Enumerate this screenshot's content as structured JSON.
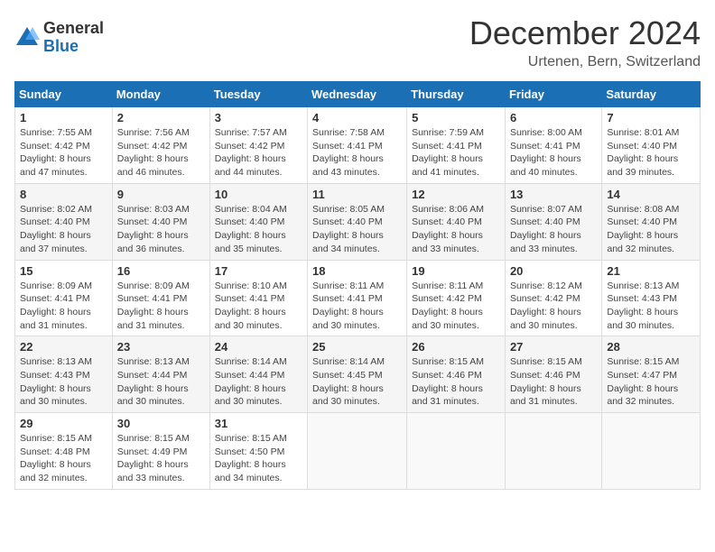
{
  "logo": {
    "general": "General",
    "blue": "Blue"
  },
  "title": "December 2024",
  "location": "Urtenen, Bern, Switzerland",
  "days_of_week": [
    "Sunday",
    "Monday",
    "Tuesday",
    "Wednesday",
    "Thursday",
    "Friday",
    "Saturday"
  ],
  "weeks": [
    [
      {
        "day": "1",
        "sunrise": "7:55 AM",
        "sunset": "4:42 PM",
        "daylight": "8 hours and 47 minutes."
      },
      {
        "day": "2",
        "sunrise": "7:56 AM",
        "sunset": "4:42 PM",
        "daylight": "8 hours and 46 minutes."
      },
      {
        "day": "3",
        "sunrise": "7:57 AM",
        "sunset": "4:42 PM",
        "daylight": "8 hours and 44 minutes."
      },
      {
        "day": "4",
        "sunrise": "7:58 AM",
        "sunset": "4:41 PM",
        "daylight": "8 hours and 43 minutes."
      },
      {
        "day": "5",
        "sunrise": "7:59 AM",
        "sunset": "4:41 PM",
        "daylight": "8 hours and 41 minutes."
      },
      {
        "day": "6",
        "sunrise": "8:00 AM",
        "sunset": "4:41 PM",
        "daylight": "8 hours and 40 minutes."
      },
      {
        "day": "7",
        "sunrise": "8:01 AM",
        "sunset": "4:40 PM",
        "daylight": "8 hours and 39 minutes."
      }
    ],
    [
      {
        "day": "8",
        "sunrise": "8:02 AM",
        "sunset": "4:40 PM",
        "daylight": "8 hours and 37 minutes."
      },
      {
        "day": "9",
        "sunrise": "8:03 AM",
        "sunset": "4:40 PM",
        "daylight": "8 hours and 36 minutes."
      },
      {
        "day": "10",
        "sunrise": "8:04 AM",
        "sunset": "4:40 PM",
        "daylight": "8 hours and 35 minutes."
      },
      {
        "day": "11",
        "sunrise": "8:05 AM",
        "sunset": "4:40 PM",
        "daylight": "8 hours and 34 minutes."
      },
      {
        "day": "12",
        "sunrise": "8:06 AM",
        "sunset": "4:40 PM",
        "daylight": "8 hours and 33 minutes."
      },
      {
        "day": "13",
        "sunrise": "8:07 AM",
        "sunset": "4:40 PM",
        "daylight": "8 hours and 33 minutes."
      },
      {
        "day": "14",
        "sunrise": "8:08 AM",
        "sunset": "4:40 PM",
        "daylight": "8 hours and 32 minutes."
      }
    ],
    [
      {
        "day": "15",
        "sunrise": "8:09 AM",
        "sunset": "4:41 PM",
        "daylight": "8 hours and 31 minutes."
      },
      {
        "day": "16",
        "sunrise": "8:09 AM",
        "sunset": "4:41 PM",
        "daylight": "8 hours and 31 minutes."
      },
      {
        "day": "17",
        "sunrise": "8:10 AM",
        "sunset": "4:41 PM",
        "daylight": "8 hours and 30 minutes."
      },
      {
        "day": "18",
        "sunrise": "8:11 AM",
        "sunset": "4:41 PM",
        "daylight": "8 hours and 30 minutes."
      },
      {
        "day": "19",
        "sunrise": "8:11 AM",
        "sunset": "4:42 PM",
        "daylight": "8 hours and 30 minutes."
      },
      {
        "day": "20",
        "sunrise": "8:12 AM",
        "sunset": "4:42 PM",
        "daylight": "8 hours and 30 minutes."
      },
      {
        "day": "21",
        "sunrise": "8:13 AM",
        "sunset": "4:43 PM",
        "daylight": "8 hours and 30 minutes."
      }
    ],
    [
      {
        "day": "22",
        "sunrise": "8:13 AM",
        "sunset": "4:43 PM",
        "daylight": "8 hours and 30 minutes."
      },
      {
        "day": "23",
        "sunrise": "8:13 AM",
        "sunset": "4:44 PM",
        "daylight": "8 hours and 30 minutes."
      },
      {
        "day": "24",
        "sunrise": "8:14 AM",
        "sunset": "4:44 PM",
        "daylight": "8 hours and 30 minutes."
      },
      {
        "day": "25",
        "sunrise": "8:14 AM",
        "sunset": "4:45 PM",
        "daylight": "8 hours and 30 minutes."
      },
      {
        "day": "26",
        "sunrise": "8:15 AM",
        "sunset": "4:46 PM",
        "daylight": "8 hours and 31 minutes."
      },
      {
        "day": "27",
        "sunrise": "8:15 AM",
        "sunset": "4:46 PM",
        "daylight": "8 hours and 31 minutes."
      },
      {
        "day": "28",
        "sunrise": "8:15 AM",
        "sunset": "4:47 PM",
        "daylight": "8 hours and 32 minutes."
      }
    ],
    [
      {
        "day": "29",
        "sunrise": "8:15 AM",
        "sunset": "4:48 PM",
        "daylight": "8 hours and 32 minutes."
      },
      {
        "day": "30",
        "sunrise": "8:15 AM",
        "sunset": "4:49 PM",
        "daylight": "8 hours and 33 minutes."
      },
      {
        "day": "31",
        "sunrise": "8:15 AM",
        "sunset": "4:50 PM",
        "daylight": "8 hours and 34 minutes."
      },
      null,
      null,
      null,
      null
    ]
  ],
  "labels": {
    "sunrise": "Sunrise:",
    "sunset": "Sunset:",
    "daylight": "Daylight:"
  }
}
